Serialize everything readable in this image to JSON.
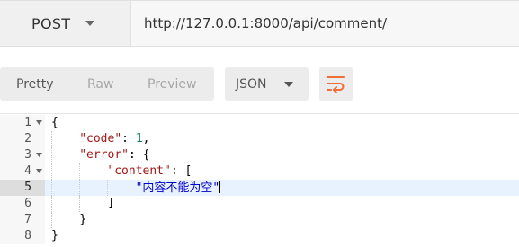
{
  "request": {
    "method": "POST",
    "url": "http://127.0.0.1:8000/api/comment/"
  },
  "response_toolbar": {
    "tabs": [
      {
        "label": "Pretty",
        "active": true
      },
      {
        "label": "Raw",
        "active": false
      },
      {
        "label": "Preview",
        "active": false
      }
    ],
    "format": "JSON",
    "wrap_icon": "wrap-lines-icon",
    "accent_color": "#f26b3a"
  },
  "editor": {
    "active_line": 5,
    "lines": [
      {
        "number": "1",
        "foldable": true,
        "indent": 0,
        "tokens": [
          {
            "t": "punct",
            "v": "{"
          }
        ]
      },
      {
        "number": "2",
        "foldable": false,
        "indent": 1,
        "tokens": [
          {
            "t": "key",
            "v": "\"code\""
          },
          {
            "t": "punct",
            "v": ": "
          },
          {
            "t": "num",
            "v": "1"
          },
          {
            "t": "punct",
            "v": ","
          }
        ]
      },
      {
        "number": "3",
        "foldable": true,
        "indent": 1,
        "tokens": [
          {
            "t": "key",
            "v": "\"error\""
          },
          {
            "t": "punct",
            "v": ": {"
          }
        ]
      },
      {
        "number": "4",
        "foldable": true,
        "indent": 2,
        "tokens": [
          {
            "t": "key",
            "v": "\"content\""
          },
          {
            "t": "punct",
            "v": ": ["
          }
        ]
      },
      {
        "number": "5",
        "foldable": false,
        "indent": 3,
        "tokens": [
          {
            "t": "str",
            "v": "\"内容不能为空\""
          }
        ]
      },
      {
        "number": "6",
        "foldable": false,
        "indent": 2,
        "tokens": [
          {
            "t": "punct",
            "v": "]"
          }
        ]
      },
      {
        "number": "7",
        "foldable": false,
        "indent": 1,
        "tokens": [
          {
            "t": "punct",
            "v": "}"
          }
        ]
      },
      {
        "number": "8",
        "foldable": false,
        "indent": 0,
        "tokens": [
          {
            "t": "punct",
            "v": "}"
          }
        ]
      }
    ]
  }
}
